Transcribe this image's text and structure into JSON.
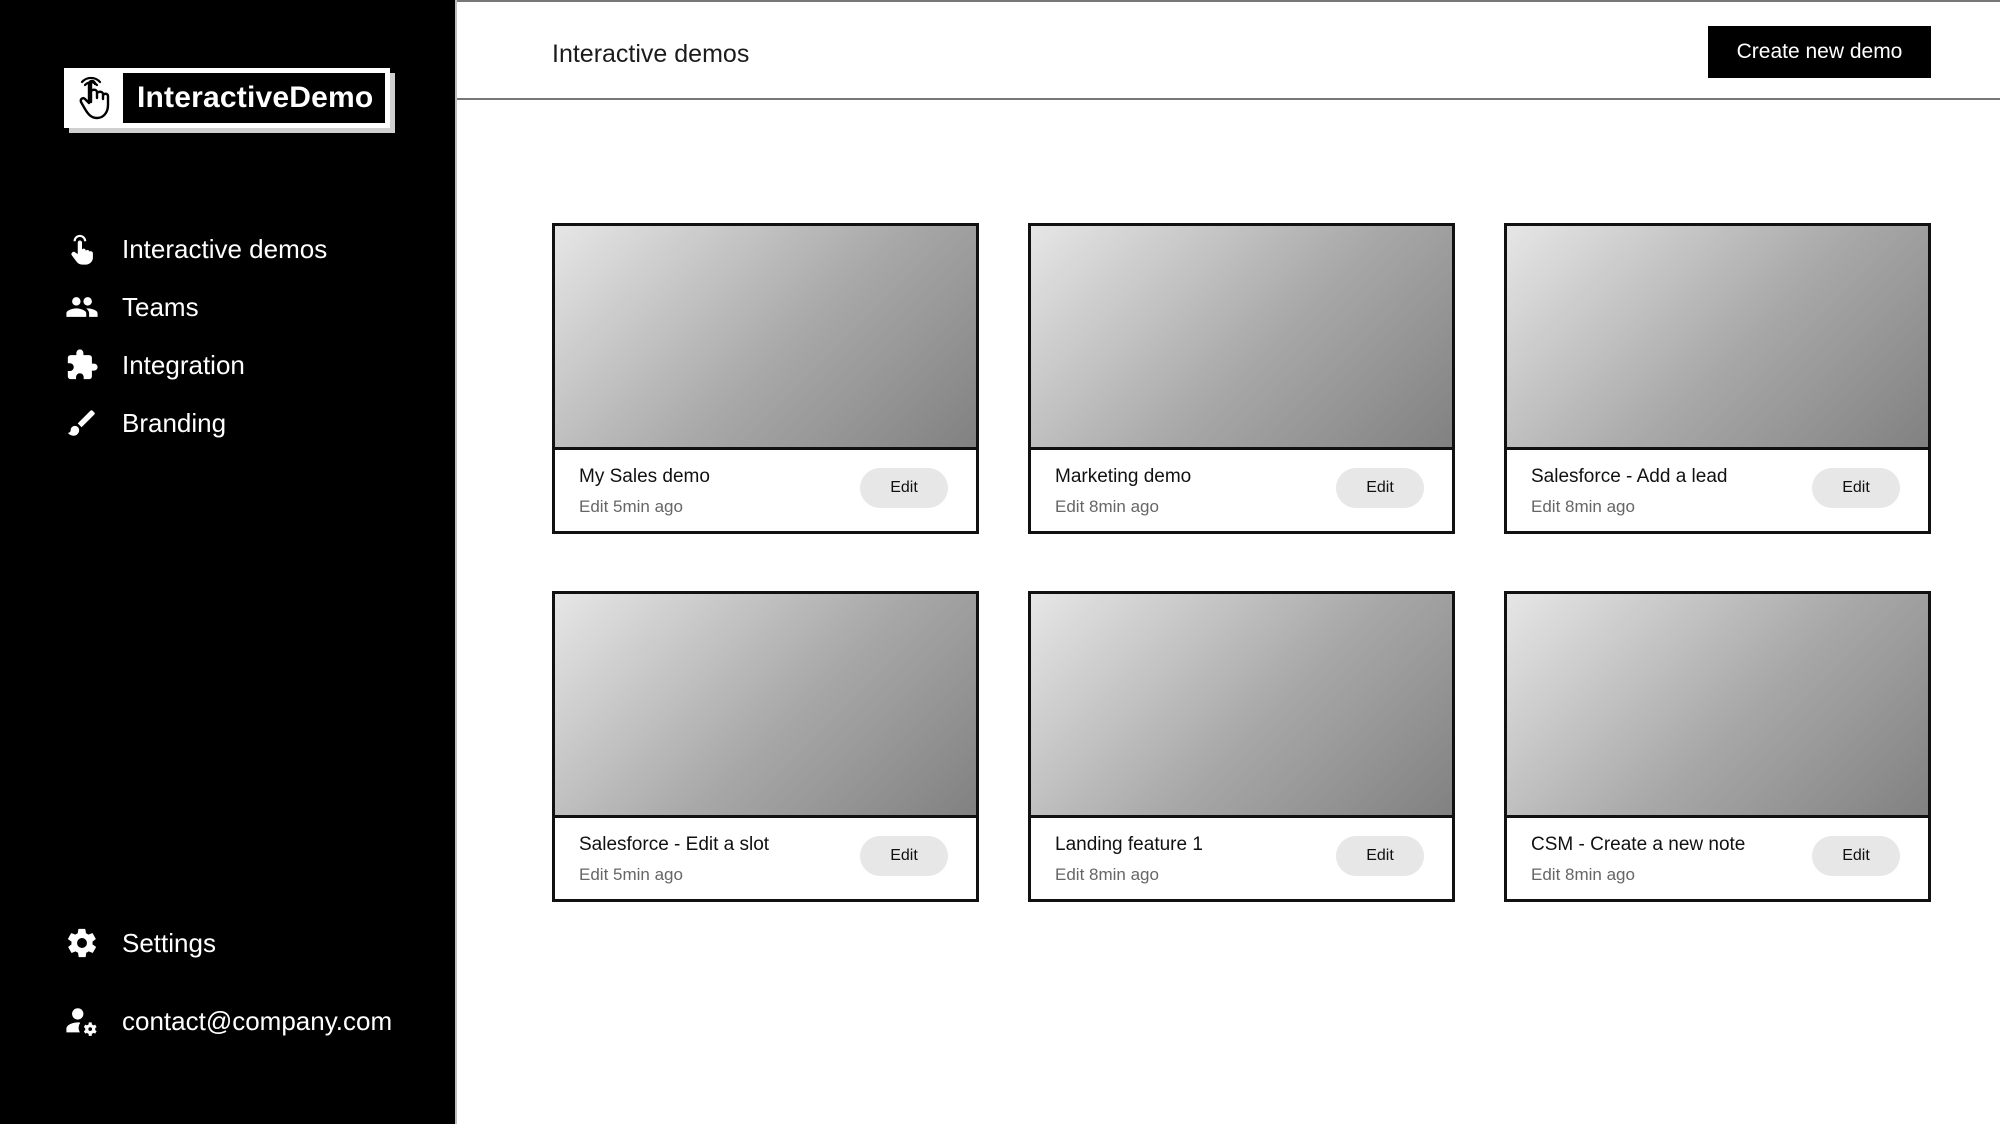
{
  "sidebar": {
    "logo_text": "InteractiveDemo",
    "nav": [
      {
        "label": "Interactive demos",
        "icon": "pointer-hand-icon"
      },
      {
        "label": "Teams",
        "icon": "people-icon"
      },
      {
        "label": "Integration",
        "icon": "puzzle-icon"
      },
      {
        "label": "Branding",
        "icon": "brush-icon"
      }
    ],
    "settings_label": "Settings",
    "account_email": "contact@company.com"
  },
  "header": {
    "title": "Interactive demos",
    "create_label": "Create new demo"
  },
  "demos": [
    {
      "title": "My Sales demo",
      "edited": "Edit 5min ago",
      "edit_label": "Edit"
    },
    {
      "title": "Marketing demo",
      "edited": "Edit 8min ago",
      "edit_label": "Edit"
    },
    {
      "title": "Salesforce - Add a lead",
      "edited": "Edit 8min ago",
      "edit_label": "Edit"
    },
    {
      "title": "Salesforce - Edit a slot",
      "edited": "Edit 5min ago",
      "edit_label": "Edit"
    },
    {
      "title": "Landing feature 1",
      "edited": "Edit 8min ago",
      "edit_label": "Edit"
    },
    {
      "title": "CSM - Create a new note",
      "edited": "Edit 8min ago",
      "edit_label": "Edit"
    }
  ],
  "colors": {
    "sidebar_bg": "#000000",
    "primary_button": "#000000",
    "edit_button": "#e7e7e7"
  }
}
